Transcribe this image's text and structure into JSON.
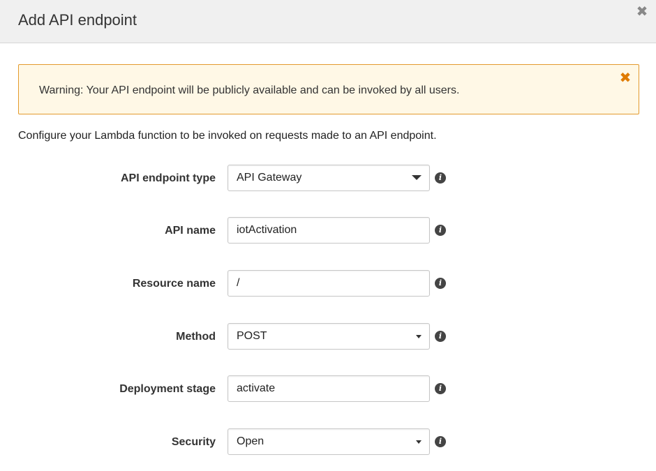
{
  "dialog": {
    "title": "Add API endpoint",
    "close_icon": "close-icon"
  },
  "warning": {
    "text": "Warning: Your API endpoint will be publicly available and can be invoked by all users.",
    "close_icon": "close-icon",
    "border_color": "#e39a2d",
    "background_color": "#fff8e6",
    "icon_color": "#e07b00"
  },
  "description": "Configure your Lambda function to be invoked on requests made to an API endpoint.",
  "form": {
    "endpoint_type": {
      "label": "API endpoint type",
      "value": "API Gateway",
      "info_icon": "info-icon"
    },
    "api_name": {
      "label": "API name",
      "value": "iotActivation",
      "info_icon": "info-icon"
    },
    "resource_name": {
      "label": "Resource name",
      "value": "/",
      "info_icon": "info-icon"
    },
    "method": {
      "label": "Method",
      "value": "POST",
      "info_icon": "info-icon"
    },
    "deployment_stage": {
      "label": "Deployment stage",
      "value": "activate",
      "info_icon": "info-icon"
    },
    "security": {
      "label": "Security",
      "value": "Open",
      "info_icon": "info-icon"
    }
  },
  "icons": {
    "info_glyph": "i",
    "close_glyph": "✖"
  }
}
